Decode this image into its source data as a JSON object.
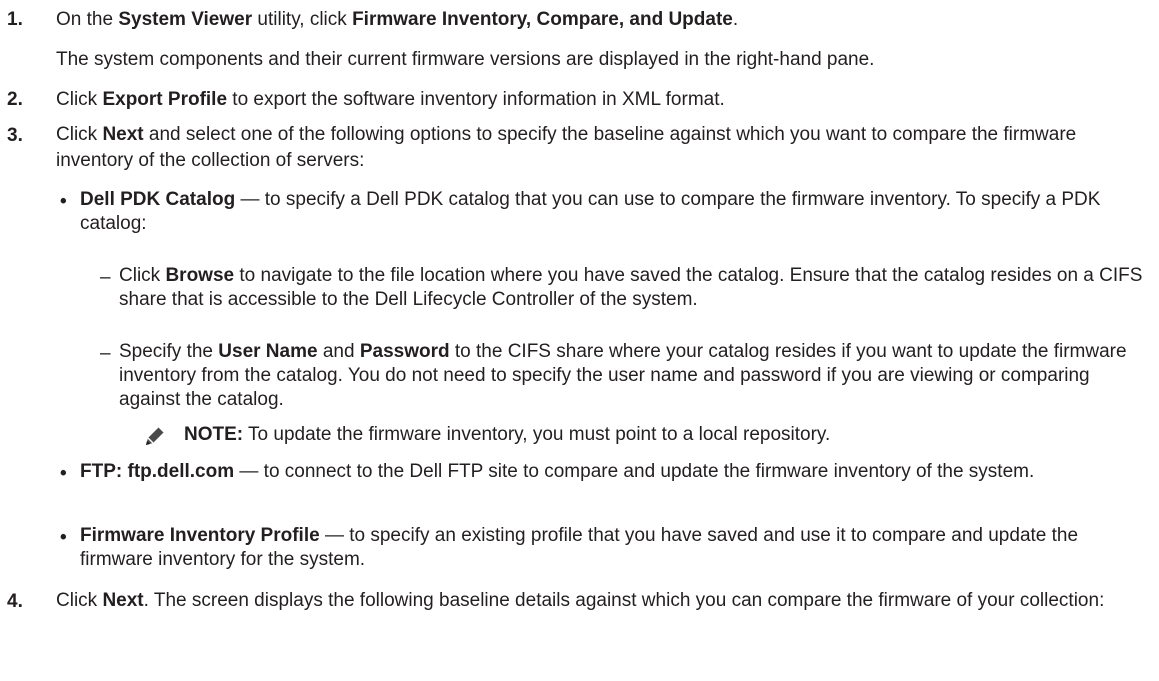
{
  "steps": [
    {
      "number": "1.",
      "parts": [
        "On the ",
        "System Viewer",
        " utility, click ",
        "Firmware Inventory, Compare, and Update",
        "."
      ],
      "detail": "The system components and their current firmware versions are displayed in the right-hand pane."
    },
    {
      "number": "2.",
      "parts": [
        "Click ",
        "Export Profile",
        " to export the software inventory information in XML format."
      ]
    },
    {
      "number": "3.",
      "parts": [
        "Click ",
        "Next",
        " and select one of the following options to specify the baseline against which you want to compare the firmware inventory of the collection of servers:"
      ],
      "options": [
        {
          "title": "Dell PDK Catalog",
          "text": " — to specify a Dell PDK catalog that you can use to compare the firmware inventory. To specify a PDK catalog:",
          "subitems": [
            {
              "parts": [
                "Click ",
                "Browse",
                " to navigate to the file location where you have saved the catalog. Ensure that the catalog resides on a CIFS share that is accessible to the Dell Lifecycle Controller of the system."
              ]
            },
            {
              "parts": [
                "Specify the ",
                "User Name",
                " and ",
                "Password",
                " to the CIFS share where your catalog resides if you want to update the firmware inventory from the catalog. You do not need to specify the user name and password if you are viewing or comparing against the catalog."
              ]
            }
          ],
          "note": {
            "label": "NOTE:",
            "text": " To update the firmware inventory, you must point to a local repository.",
            "icon": "note-pencil-icon"
          }
        },
        {
          "title": "FTP: ftp.dell.com",
          "text": " — to connect to the Dell FTP site to compare and update the firmware inventory of the system."
        },
        {
          "title": "Firmware Inventory Profile",
          "text": " — to specify an existing profile that you have saved and use it to compare and update the firmware inventory for the system."
        }
      ]
    },
    {
      "number": "4.",
      "parts": [
        "Click ",
        "Next",
        ". The screen displays the following baseline details against which you can compare the firmware of your collection:"
      ]
    }
  ]
}
